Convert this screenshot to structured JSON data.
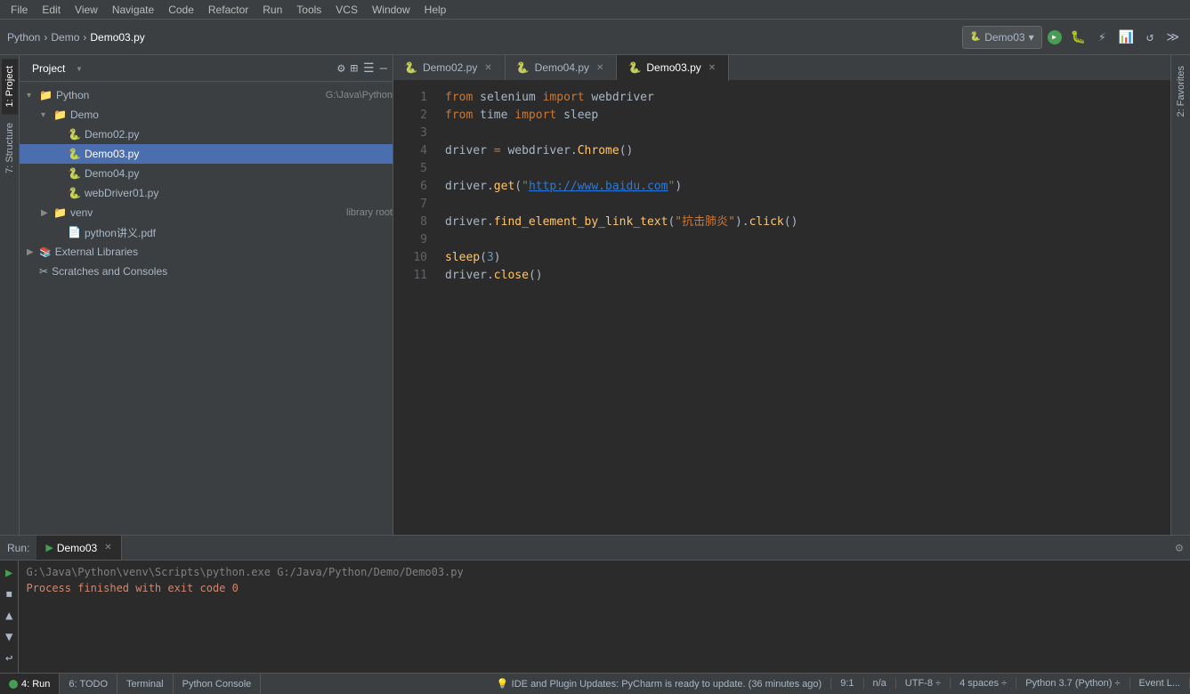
{
  "menuBar": {
    "items": [
      "File",
      "Edit",
      "View",
      "Navigate",
      "Code",
      "Refactor",
      "Run",
      "Tools",
      "VCS",
      "Window",
      "Help"
    ]
  },
  "toolbar": {
    "breadcrumb": [
      "Python",
      "Demo",
      "Demo03.py"
    ],
    "configLabel": "Demo03",
    "chevron": "▾"
  },
  "sidebar": {
    "tabLabel": "Project",
    "tree": [
      {
        "indent": 0,
        "arrow": "▾",
        "icon": "📁",
        "label": "Python",
        "path": "G:\\Java\\Python",
        "type": "root"
      },
      {
        "indent": 1,
        "arrow": "▾",
        "icon": "📁",
        "label": "Demo",
        "path": "",
        "type": "folder"
      },
      {
        "indent": 2,
        "arrow": "",
        "icon": "🐍",
        "label": "Demo02.py",
        "path": "",
        "type": "file"
      },
      {
        "indent": 2,
        "arrow": "",
        "icon": "🐍",
        "label": "Demo03.py",
        "path": "",
        "type": "file",
        "selected": true
      },
      {
        "indent": 2,
        "arrow": "",
        "icon": "🐍",
        "label": "Demo04.py",
        "path": "",
        "type": "file"
      },
      {
        "indent": 2,
        "arrow": "",
        "icon": "🐍",
        "label": "webDriver01.py",
        "path": "",
        "type": "file"
      },
      {
        "indent": 1,
        "arrow": "▶",
        "icon": "📁",
        "label": "venv",
        "path": "library root",
        "type": "folder"
      },
      {
        "indent": 2,
        "arrow": "",
        "icon": "📄",
        "label": "python讲义.pdf",
        "path": "",
        "type": "file"
      },
      {
        "indent": 0,
        "arrow": "▶",
        "icon": "📚",
        "label": "External Libraries",
        "path": "",
        "type": "folder"
      },
      {
        "indent": 0,
        "arrow": "",
        "icon": "✂️",
        "label": "Scratches and Consoles",
        "path": "",
        "type": "folder"
      }
    ]
  },
  "editorTabs": [
    {
      "icon": "🐍",
      "label": "Demo02.py",
      "active": false
    },
    {
      "icon": "🐍",
      "label": "Demo04.py",
      "active": false
    },
    {
      "icon": "🐍",
      "label": "Demo03.py",
      "active": true
    }
  ],
  "codeLines": [
    {
      "num": 1,
      "content": "from selenium import webdriver",
      "type": "code"
    },
    {
      "num": 2,
      "content": "from time import sleep",
      "type": "code"
    },
    {
      "num": 3,
      "content": "",
      "type": "empty"
    },
    {
      "num": 4,
      "content": "driver = webdriver.Chrome()",
      "type": "code"
    },
    {
      "num": 5,
      "content": "",
      "type": "empty"
    },
    {
      "num": 6,
      "content": "driver.get(\"http://www.baidu.com\")",
      "type": "code"
    },
    {
      "num": 7,
      "content": "",
      "type": "empty"
    },
    {
      "num": 8,
      "content": "driver.find_element_by_link_text(\"抗击肺炎\").click()",
      "type": "code"
    },
    {
      "num": 9,
      "content": "",
      "type": "empty"
    },
    {
      "num": 10,
      "content": "sleep(3)",
      "type": "code"
    },
    {
      "num": 11,
      "content": "driver.close()",
      "type": "code"
    }
  ],
  "bottomPanel": {
    "tabLabel": "Run:",
    "runLabel": "Demo03",
    "consolePath": "G:\\Java\\Python\\venv\\Scripts\\python.exe G:/Java/Python/Demo/Demo03.py",
    "exitMessage": "Process finished with exit code 0"
  },
  "bottomStatusTabs": [
    {
      "label": "4: Run",
      "active": true
    },
    {
      "label": "6: TODO",
      "active": false
    },
    {
      "label": "Terminal",
      "active": false
    },
    {
      "label": "Python Console",
      "active": false
    }
  ],
  "statusBar": {
    "leftMessage": "💡 IDE and Plugin Updates: PyCharm is ready to update. (36 minutes ago)",
    "position": "9:1",
    "na": "n/a",
    "encoding": "UTF-8 ÷",
    "indent": "4 spaces ÷",
    "pythonVersion": "Python 3.7 (Python) ÷",
    "eventLog": "Event L..."
  },
  "verticalTabs": [
    {
      "label": "1: Project",
      "active": true
    },
    {
      "label": "7: Structure",
      "active": false
    }
  ],
  "rightVerticalTabs": [
    {
      "label": "2: Favorites",
      "active": false
    }
  ]
}
